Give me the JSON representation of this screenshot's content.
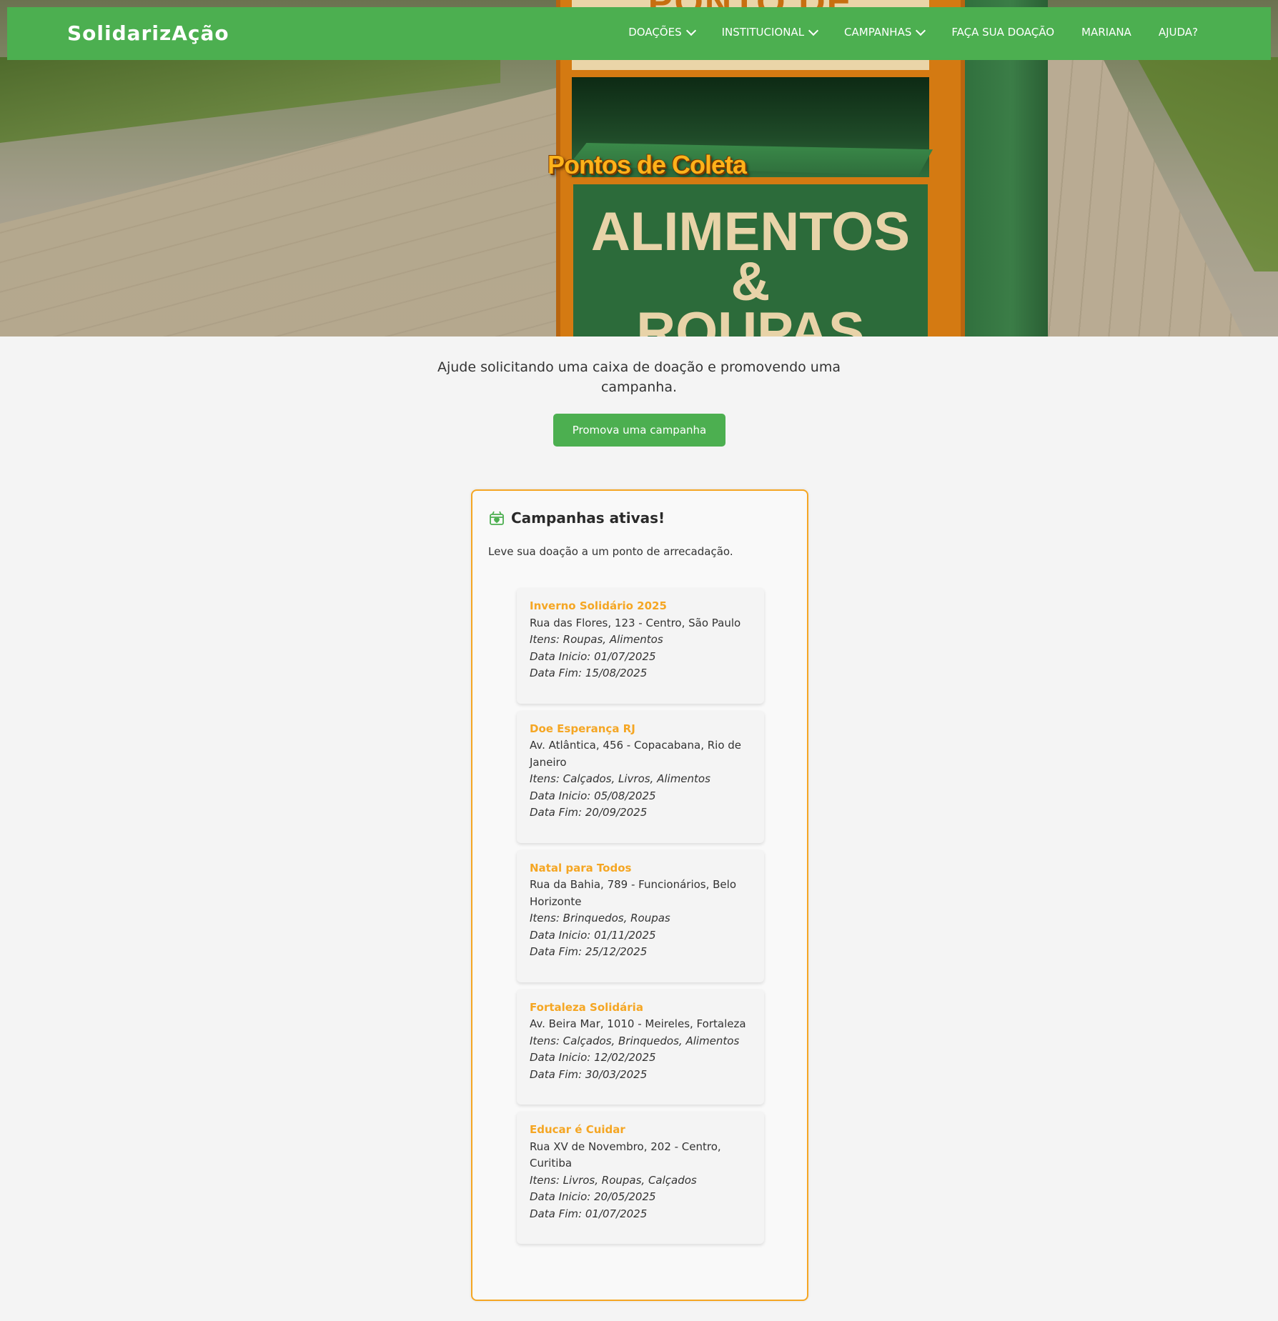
{
  "app": {
    "logo": "SolidarizAção"
  },
  "nav": {
    "items": [
      {
        "label": "DOAÇÕES",
        "has_dropdown": true
      },
      {
        "label": "INSTITUCIONAL",
        "has_dropdown": true
      },
      {
        "label": "CAMPANHAS",
        "has_dropdown": true
      },
      {
        "label": "FAÇA SUA DOAÇÃO",
        "has_dropdown": false
      },
      {
        "label": "MARIANA",
        "has_dropdown": false
      },
      {
        "label": "AJUDA?",
        "has_dropdown": false
      }
    ]
  },
  "hero": {
    "title": "Pontos de Coleta",
    "box_sign": "PONTO DE COLETA",
    "box_panel_line1": "ALIMENTOS",
    "box_panel_line2": "&",
    "box_panel_line3": "ROUPAS"
  },
  "intro": {
    "text": "Ajude solicitando uma caixa de doação e promovendo uma campanha.",
    "cta_label": "Promova uma campanha"
  },
  "campaigns": {
    "title": "Campanhas ativas!",
    "subtitle": "Leve sua doação a um ponto de arrecadação.",
    "icon": "gift-box-icon",
    "items": [
      {
        "name": "Inverno Solidário 2025",
        "address": "Rua das Flores, 123 - Centro, São Paulo",
        "items": "Itens: Roupas, Alimentos",
        "start": "Data Inicio: 01/07/2025",
        "end": "Data Fim: 15/08/2025"
      },
      {
        "name": "Doe Esperança RJ",
        "address": "Av. Atlântica, 456 - Copacabana, Rio de Janeiro",
        "items": "Itens: Calçados, Livros, Alimentos",
        "start": "Data Inicio: 05/08/2025",
        "end": "Data Fim: 20/09/2025"
      },
      {
        "name": "Natal para Todos",
        "address": "Rua da Bahia, 789 - Funcionários, Belo Horizonte",
        "items": "Itens: Brinquedos, Roupas",
        "start": "Data Inicio: 01/11/2025",
        "end": "Data Fim: 25/12/2025"
      },
      {
        "name": "Fortaleza Solidária",
        "address": "Av. Beira Mar, 1010 - Meireles, Fortaleza",
        "items": "Itens: Calçados, Brinquedos, Alimentos",
        "start": "Data Inicio: 12/02/2025",
        "end": "Data Fim: 30/03/2025"
      },
      {
        "name": "Educar é Cuidar",
        "address": "Rua XV de Novembro, 202 - Centro, Curitiba",
        "items": "Itens: Livros, Roupas, Calçados",
        "start": "Data Inicio: 20/05/2025",
        "end": "Data Fim: 01/07/2025"
      }
    ]
  },
  "colors": {
    "primary": "#4caf50",
    "accent": "#f5a623",
    "background": "#f4f4f4"
  }
}
